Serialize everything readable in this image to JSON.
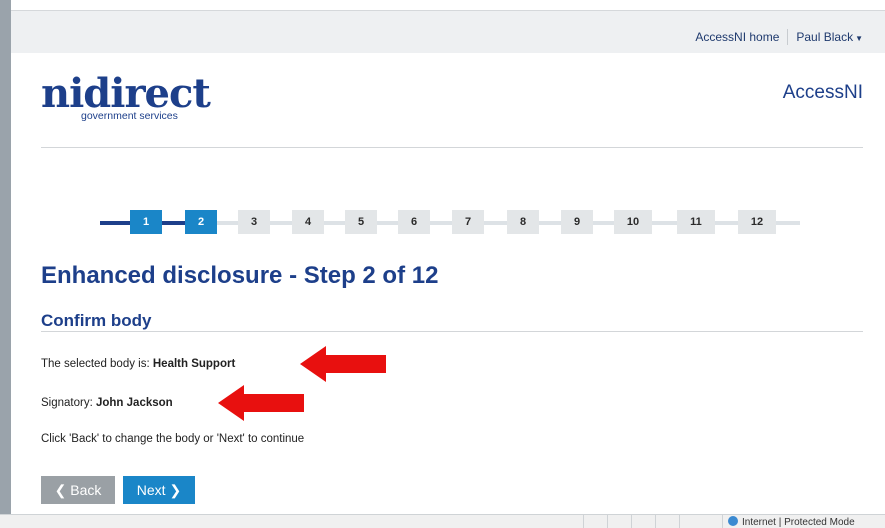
{
  "topbar": {
    "links": [
      "AccessNI home",
      "Paul Black"
    ]
  },
  "logo": {
    "wordmark": "nidirect",
    "tagline": "government services"
  },
  "brand": "AccessNI",
  "stepper": {
    "current": 2,
    "steps": [
      "1",
      "2",
      "3",
      "4",
      "5",
      "6",
      "7",
      "8",
      "9",
      "10",
      "11",
      "12"
    ]
  },
  "page": {
    "title": "Enhanced disclosure - Step 2 of 12",
    "subtitle": "Confirm body",
    "body_prefix": "The selected body is: ",
    "body_value": "Health Support",
    "signatory_prefix": "Signatory: ",
    "signatory_value": "John Jackson",
    "instructions": "Click 'Back' to change the body or 'Next' to continue"
  },
  "buttons": {
    "back": "Back",
    "next": "Next"
  },
  "statusbar": {
    "zone": "Internet | Protected Mode"
  },
  "colors": {
    "navy": "#1d3f8a",
    "accent": "#1a86c8",
    "arrow": "#e8100f",
    "back_button": "#9aa0a5"
  }
}
